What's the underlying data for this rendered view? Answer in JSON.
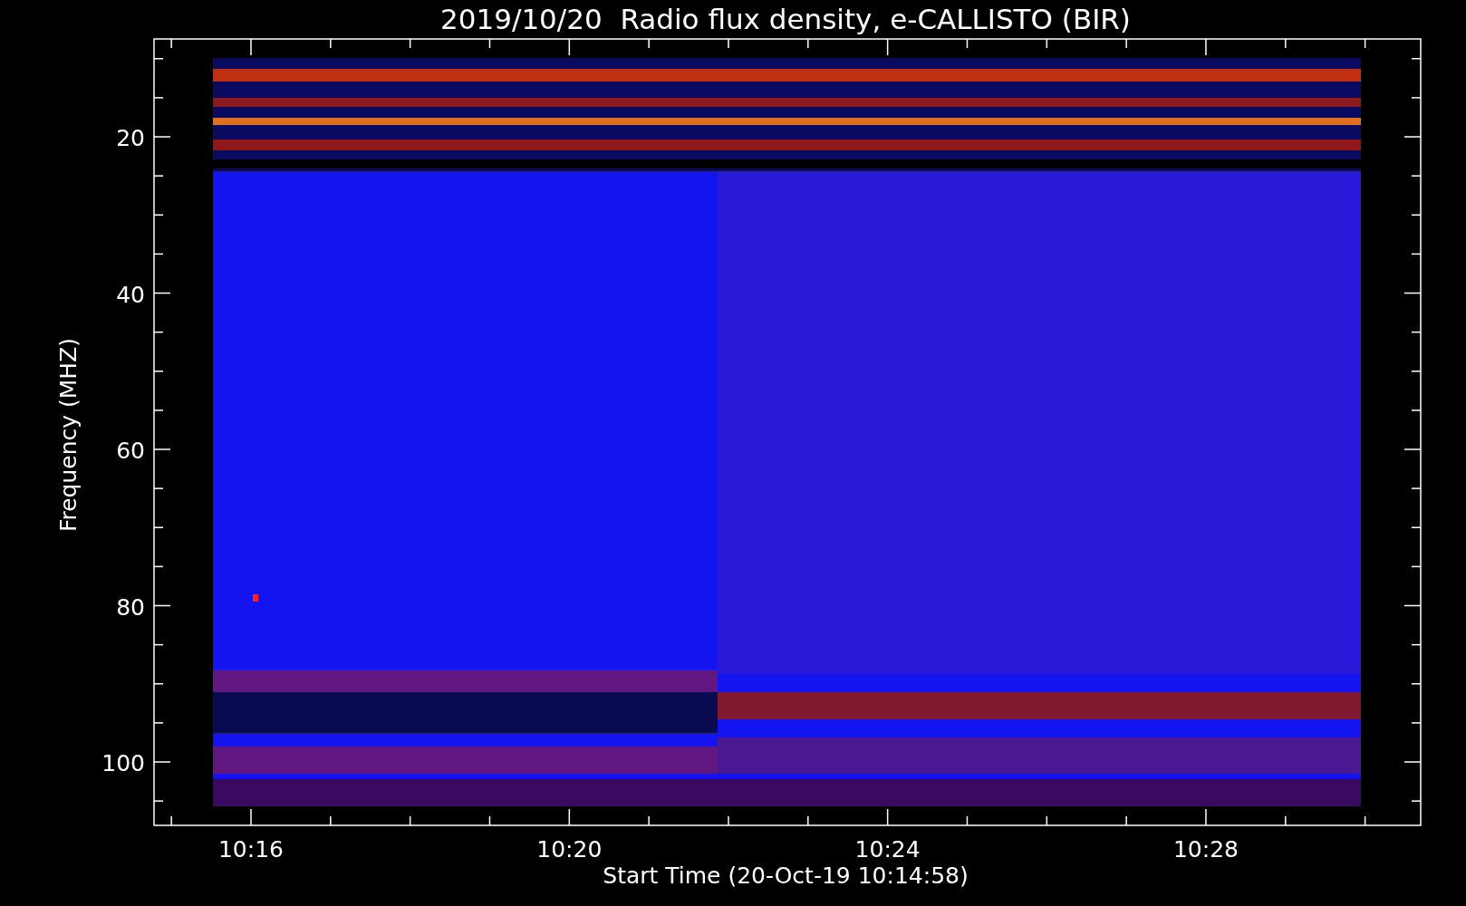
{
  "title": "2019/10/20  Radio flux density, e-CALLISTO (BIR)",
  "y_axis": {
    "label": "Frequency (MHZ)",
    "ticks": [
      "20",
      "40",
      "60",
      "80",
      "100"
    ]
  },
  "x_axis": {
    "label": "Start Time (20-Oct-19 10:14:58)",
    "ticks": [
      "10:16",
      "10:20",
      "10:24",
      "10:28"
    ]
  }
}
